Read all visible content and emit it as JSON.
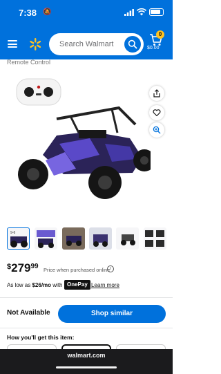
{
  "status": {
    "time": "7:38",
    "battery_level": 0.8
  },
  "header": {
    "search_placeholder": "Search Walmart",
    "cart_count": "0",
    "cart_total": "$0.00"
  },
  "product": {
    "partial_text": "Remote Control",
    "thumb_label": "9-6",
    "thumbnail_count": 7,
    "selected_thumbnail": 1
  },
  "price": {
    "currency": "$",
    "whole": "279",
    "cents": "99",
    "note": "Price when purchased online",
    "info_glyph": "i"
  },
  "financing": {
    "prefix": "As low as ",
    "amount": "$26/mo",
    "suffix": " with",
    "provider": "OnePay",
    "learn_more": "Learn more"
  },
  "availability": {
    "status": "Not Available",
    "shop_similar": "Shop similar"
  },
  "fulfillment": {
    "heading": "How you'll get this item:"
  },
  "browser": {
    "url": "walmart.com"
  },
  "colors": {
    "brand_blue": "#0071dc",
    "spark_yellow": "#ffc220"
  },
  "icons": [
    "menu-icon",
    "walmart-spark-icon",
    "search-icon",
    "cart-icon",
    "share-icon",
    "heart-icon",
    "zoom-icon",
    "info-icon"
  ]
}
